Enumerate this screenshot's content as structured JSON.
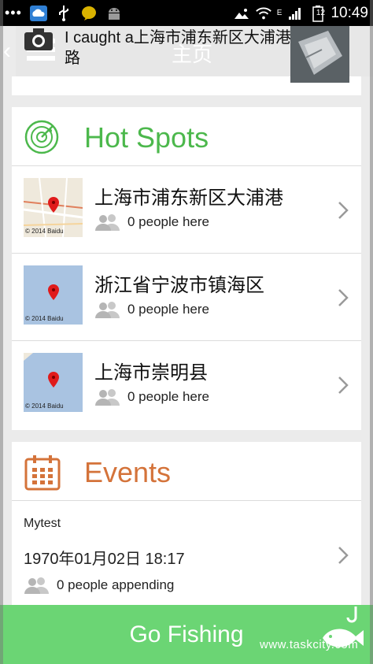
{
  "status_bar": {
    "dots": "•••",
    "time": "10:49",
    "battery": "12",
    "network": "E"
  },
  "header": {
    "title": "主页",
    "back": "‹"
  },
  "catch_banner": {
    "text": "I caught a上海市浦东新区大浦港路"
  },
  "hot_spots": {
    "title": "Hot Spots",
    "accent": "#4cb84c",
    "items": [
      {
        "name": "上海市浦东新区大浦港",
        "people": "0 people here",
        "map_copy": "© 2014 Baidu"
      },
      {
        "name": "浙江省宁波市镇海区",
        "people": "0 people here",
        "map_copy": "© 2014 Baidu"
      },
      {
        "name": "上海市崇明县",
        "people": "0 people here",
        "map_copy": "© 2014 Baidu"
      }
    ]
  },
  "events": {
    "title": "Events",
    "accent": "#d4733a",
    "items": [
      {
        "name": "Mytest",
        "date": "1970年01月02日 18:17",
        "people": "0 people appending"
      }
    ]
  },
  "go_fishing": {
    "label": "Go Fishing",
    "watermark": "www.taskcity.com",
    "color": "#6bd574"
  }
}
